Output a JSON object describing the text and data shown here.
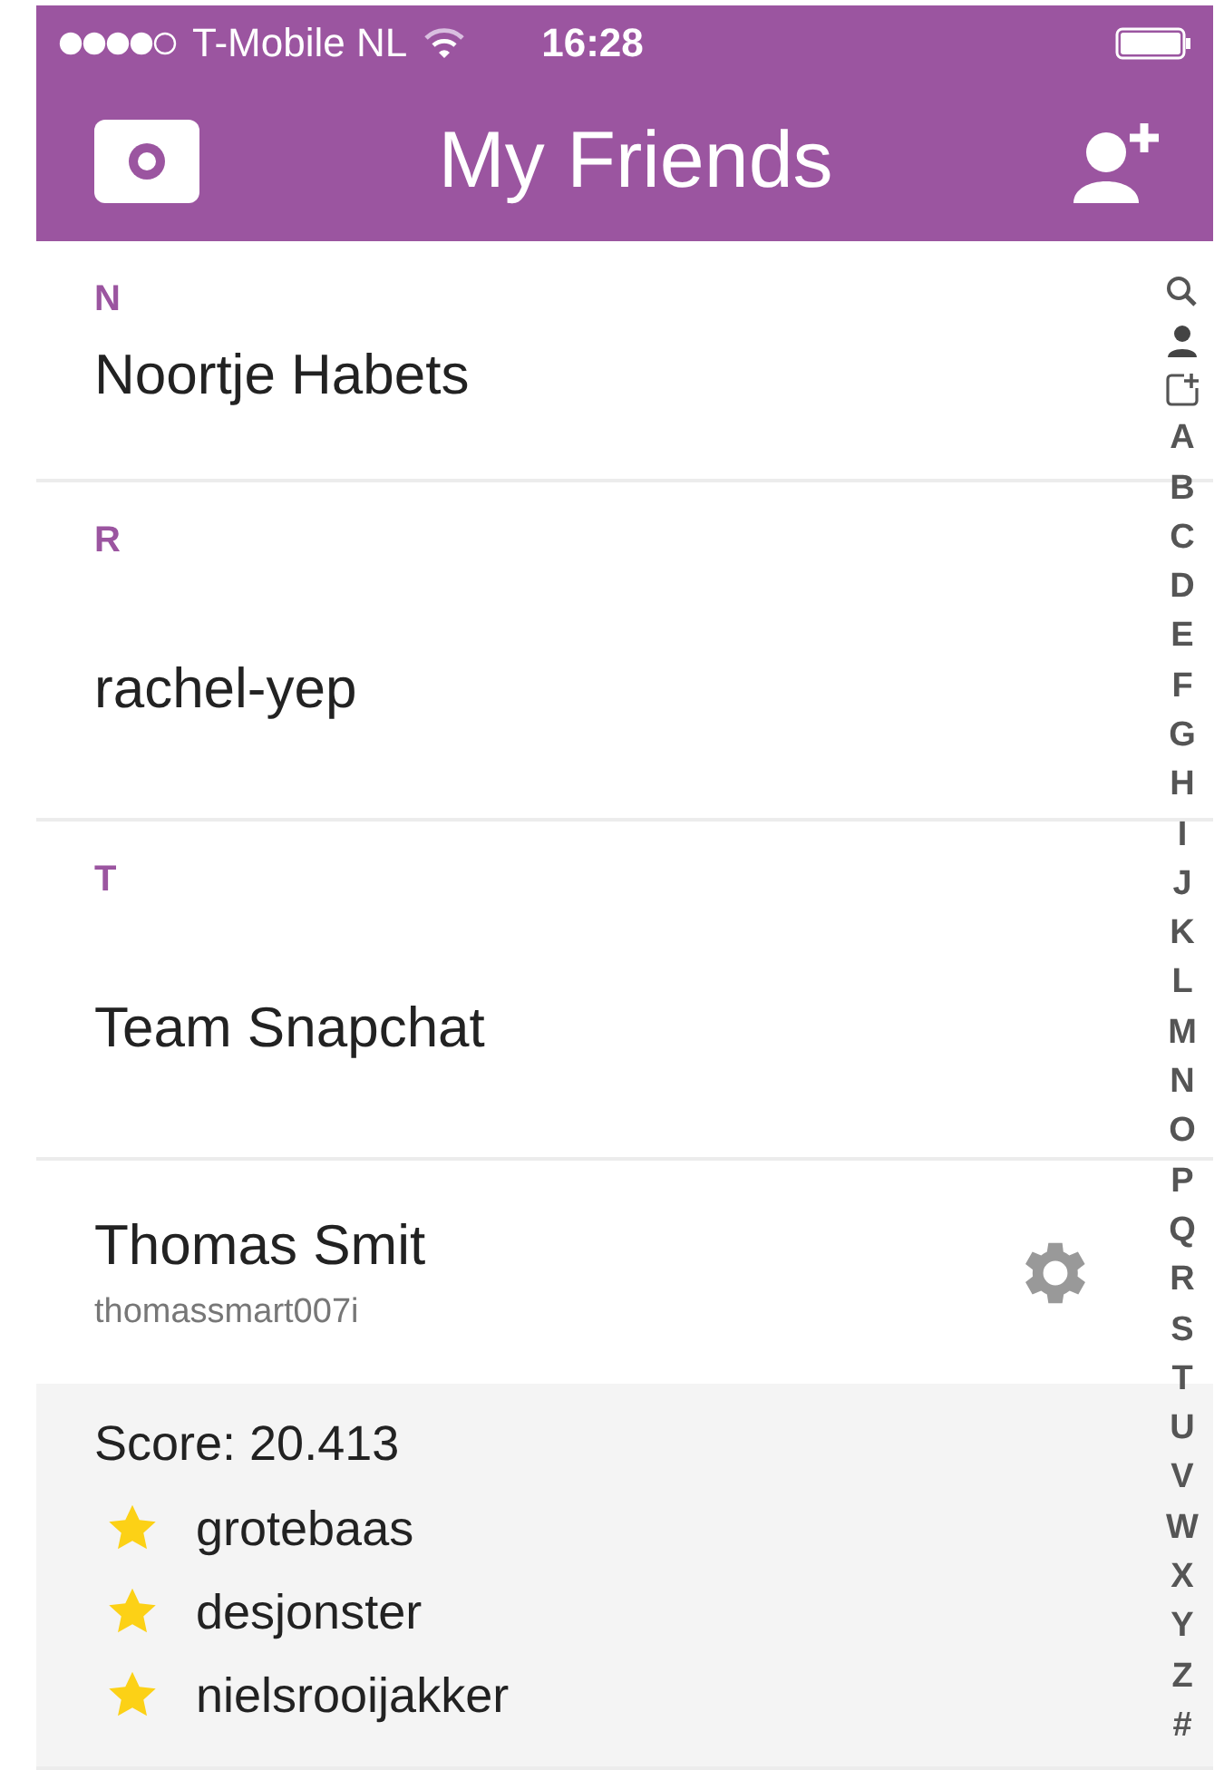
{
  "status_bar": {
    "carrier": "T-Mobile NL",
    "time": "16:28"
  },
  "nav_bar": {
    "title": "My Friends"
  },
  "sections": [
    {
      "letter": "N",
      "friends": [
        {
          "name": "Noortje Habets",
          "expanded": false
        }
      ]
    },
    {
      "letter": "R",
      "friends": [
        {
          "name": "rachel-yep",
          "expanded": false
        }
      ]
    },
    {
      "letter": "T",
      "friends": [
        {
          "name": "Team Snapchat",
          "expanded": false
        },
        {
          "name": "Thomas Smit",
          "username": "thomassmart007i",
          "expanded": true,
          "score": "Score: 20.413",
          "best_friends": [
            "grotebaas",
            "desjonster",
            "nielsrooijakker"
          ]
        }
      ]
    }
  ],
  "index": [
    {
      "kind": "search"
    },
    {
      "kind": "person"
    },
    {
      "kind": "add"
    },
    {
      "kind": "letter",
      "label": "A"
    },
    {
      "kind": "letter",
      "label": "B"
    },
    {
      "kind": "letter",
      "label": "C"
    },
    {
      "kind": "letter",
      "label": "D"
    },
    {
      "kind": "letter",
      "label": "E"
    },
    {
      "kind": "letter",
      "label": "F"
    },
    {
      "kind": "letter",
      "label": "G"
    },
    {
      "kind": "letter",
      "label": "H"
    },
    {
      "kind": "letter",
      "label": "I"
    },
    {
      "kind": "letter",
      "label": "J"
    },
    {
      "kind": "letter",
      "label": "K"
    },
    {
      "kind": "letter",
      "label": "L"
    },
    {
      "kind": "letter",
      "label": "M"
    },
    {
      "kind": "letter",
      "label": "N"
    },
    {
      "kind": "letter",
      "label": "O"
    },
    {
      "kind": "letter",
      "label": "P"
    },
    {
      "kind": "letter",
      "label": "Q"
    },
    {
      "kind": "letter",
      "label": "R"
    },
    {
      "kind": "letter",
      "label": "S"
    },
    {
      "kind": "letter",
      "label": "T"
    },
    {
      "kind": "letter",
      "label": "U"
    },
    {
      "kind": "letter",
      "label": "V"
    },
    {
      "kind": "letter",
      "label": "W"
    },
    {
      "kind": "letter",
      "label": "X"
    },
    {
      "kind": "letter",
      "label": "Y"
    },
    {
      "kind": "letter",
      "label": "Z"
    },
    {
      "kind": "letter",
      "label": "#"
    }
  ]
}
